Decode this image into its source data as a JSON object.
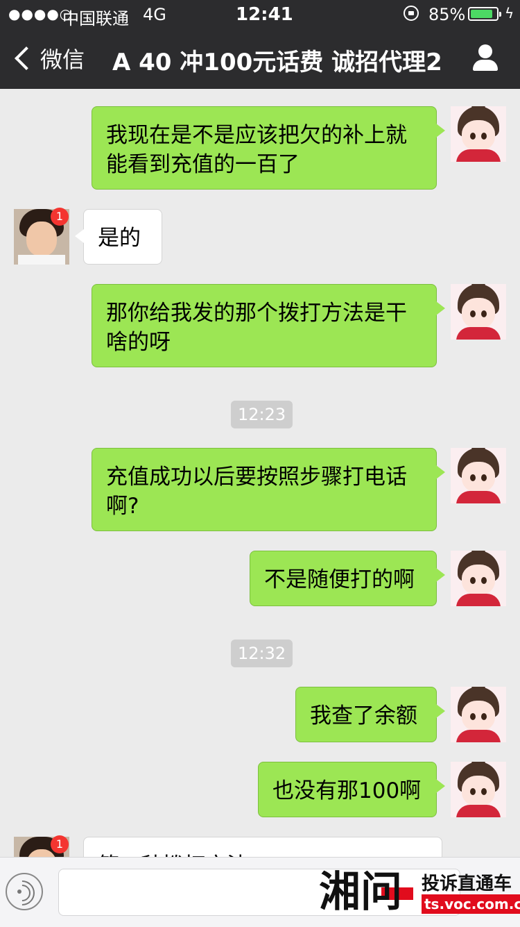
{
  "status_bar": {
    "signal": "●●●●○",
    "carrier": "中国联通",
    "network": "4G",
    "time": "12:41",
    "battery_percent": "85%",
    "battery_level": 0.85
  },
  "nav": {
    "back_label": "微信",
    "title": "A 40 冲100元话费 诚招代理2"
  },
  "messages": {
    "m1": {
      "line1": "我现在是不是应该把欠的补上就",
      "line2": "能看到充值的一百了"
    },
    "m2": {
      "text": "是的",
      "badge": "1"
    },
    "m3": {
      "line1": "那你给我发的那个拨打方法是干",
      "line2": "啥的呀"
    },
    "t1": "12:23",
    "m4": {
      "line1": "充值成功以后要按照步骤打电话",
      "line2": "啊?"
    },
    "m5": {
      "text": "不是随便打的啊"
    },
    "t2": "12:32",
    "m6": {
      "text": "我查了余额"
    },
    "m7": {
      "text": "也没有那100啊"
    },
    "m8": {
      "text": "第一种拨打方法",
      "badge": "1"
    }
  },
  "watermark": {
    "logo": "湘问",
    "tagline": "投诉直通车",
    "url": "ts.voc.com.cn"
  }
}
